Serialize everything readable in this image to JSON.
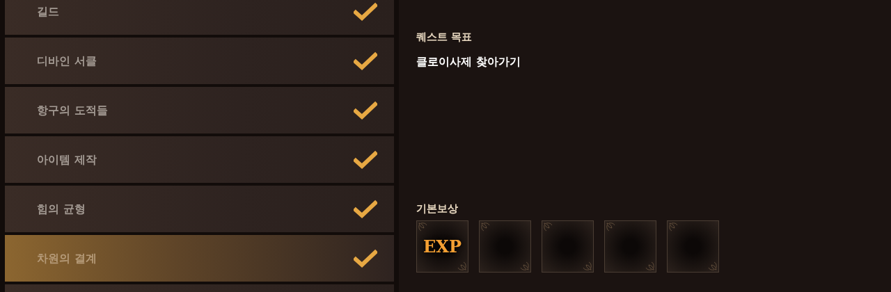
{
  "quests": [
    {
      "label": "길드",
      "completed": true,
      "selected": false
    },
    {
      "label": "디바인 서클",
      "completed": true,
      "selected": false
    },
    {
      "label": "항구의 도적들",
      "completed": true,
      "selected": false
    },
    {
      "label": "아이템 제작",
      "completed": true,
      "selected": false
    },
    {
      "label": "힘의 균형",
      "completed": true,
      "selected": false
    },
    {
      "label": "차원의 결계",
      "completed": true,
      "selected": true
    }
  ],
  "objective": {
    "heading": "퀘스트 목표",
    "text": "클로이사제 찾아가기"
  },
  "rewards": {
    "heading": "기본보상",
    "slots": [
      {
        "kind": "exp",
        "label": "EXP"
      },
      {
        "kind": "empty"
      },
      {
        "kind": "empty"
      },
      {
        "kind": "empty"
      },
      {
        "kind": "empty"
      }
    ]
  }
}
